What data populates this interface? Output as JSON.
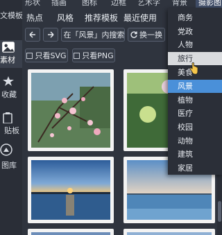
{
  "sidebar": {
    "items": [
      {
        "label": "文模板"
      },
      {
        "label": "素材"
      },
      {
        "label": "收藏"
      },
      {
        "label": "贴板"
      },
      {
        "label": "图库"
      }
    ]
  },
  "topnav": {
    "tabs": [
      "形状",
      "插画",
      "图标",
      "边框",
      "艺术字",
      "背景",
      "摄影图"
    ]
  },
  "subtabs": [
    "热点",
    "风格",
    "推荐模板",
    "最近使用"
  ],
  "toolbar": {
    "search_in_label": "在「风景」内搜索",
    "refresh_label": "换一换"
  },
  "filters": {
    "svg_label": "只看SVG",
    "png_label": "只看PNG"
  },
  "dropdown": {
    "items": [
      "商务",
      "党政",
      "人物",
      "旅行",
      "美食",
      "风景",
      "植物",
      "医疗",
      "校园",
      "动物",
      "建筑",
      "家居"
    ],
    "hover": "旅行",
    "selected": "风景"
  },
  "colors": {
    "selected": "#4a90d9",
    "hover": "#d9dbde"
  }
}
